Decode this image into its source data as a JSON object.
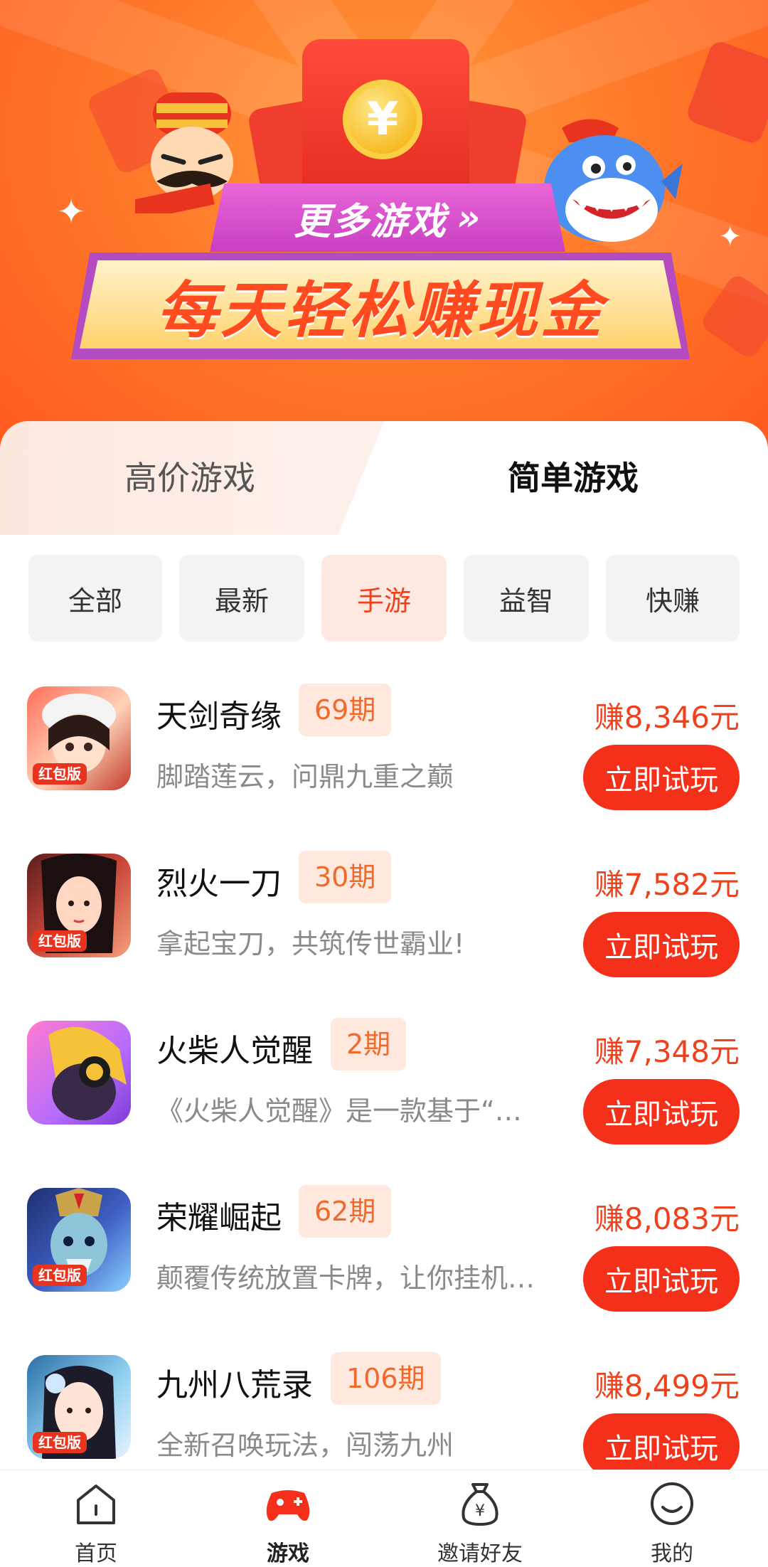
{
  "banner": {
    "more_games": "更多游戏",
    "more_arrows": "»",
    "slogan": "每天轻松赚现金",
    "coin_symbol": "¥"
  },
  "tabs": [
    {
      "label": "高价游戏",
      "active": false
    },
    {
      "label": "简单游戏",
      "active": true
    }
  ],
  "filters": [
    {
      "label": "全部",
      "active": false
    },
    {
      "label": "最新",
      "active": false
    },
    {
      "label": "手游",
      "active": true
    },
    {
      "label": "益智",
      "active": false
    },
    {
      "label": "快赚",
      "active": false
    }
  ],
  "games": [
    {
      "name": "天剑奇缘",
      "period": "69期",
      "desc": "脚踏莲云，问鼎九重之巅",
      "earn": "赚8,346元",
      "button": "立即试玩",
      "badge": "红包版"
    },
    {
      "name": "烈火一刀",
      "period": "30期",
      "desc": "拿起宝刀，共筑传世霸业!",
      "earn": "赚7,582元",
      "button": "立即试玩",
      "badge": "红包版"
    },
    {
      "name": "火柴人觉醒",
      "period": "2期",
      "desc": "《火柴人觉醒》是一款基于“…",
      "earn": "赚7,348元",
      "button": "立即试玩",
      "badge": ""
    },
    {
      "name": "荣耀崛起",
      "period": "62期",
      "desc": "颠覆传统放置卡牌，让你挂机…",
      "earn": "赚8,083元",
      "button": "立即试玩",
      "badge": "红包版"
    },
    {
      "name": "九州八荒录",
      "period": "106期",
      "desc": "全新召唤玩法，闯荡九州",
      "earn": "赚8,499元",
      "button": "立即试玩",
      "badge": "红包版"
    }
  ],
  "nav": [
    {
      "label": "首页",
      "icon": "home-icon",
      "active": false
    },
    {
      "label": "游戏",
      "icon": "gamepad-icon",
      "active": true
    },
    {
      "label": "邀请好友",
      "icon": "money-bag-icon",
      "active": false
    },
    {
      "label": "我的",
      "icon": "smile-face-icon",
      "active": false
    }
  ],
  "colors": {
    "accent": "#f5301a",
    "banner_orange": "#ff7a2a",
    "period_bg": "#ffe9df",
    "chip_active_bg": "#fde8e2"
  }
}
